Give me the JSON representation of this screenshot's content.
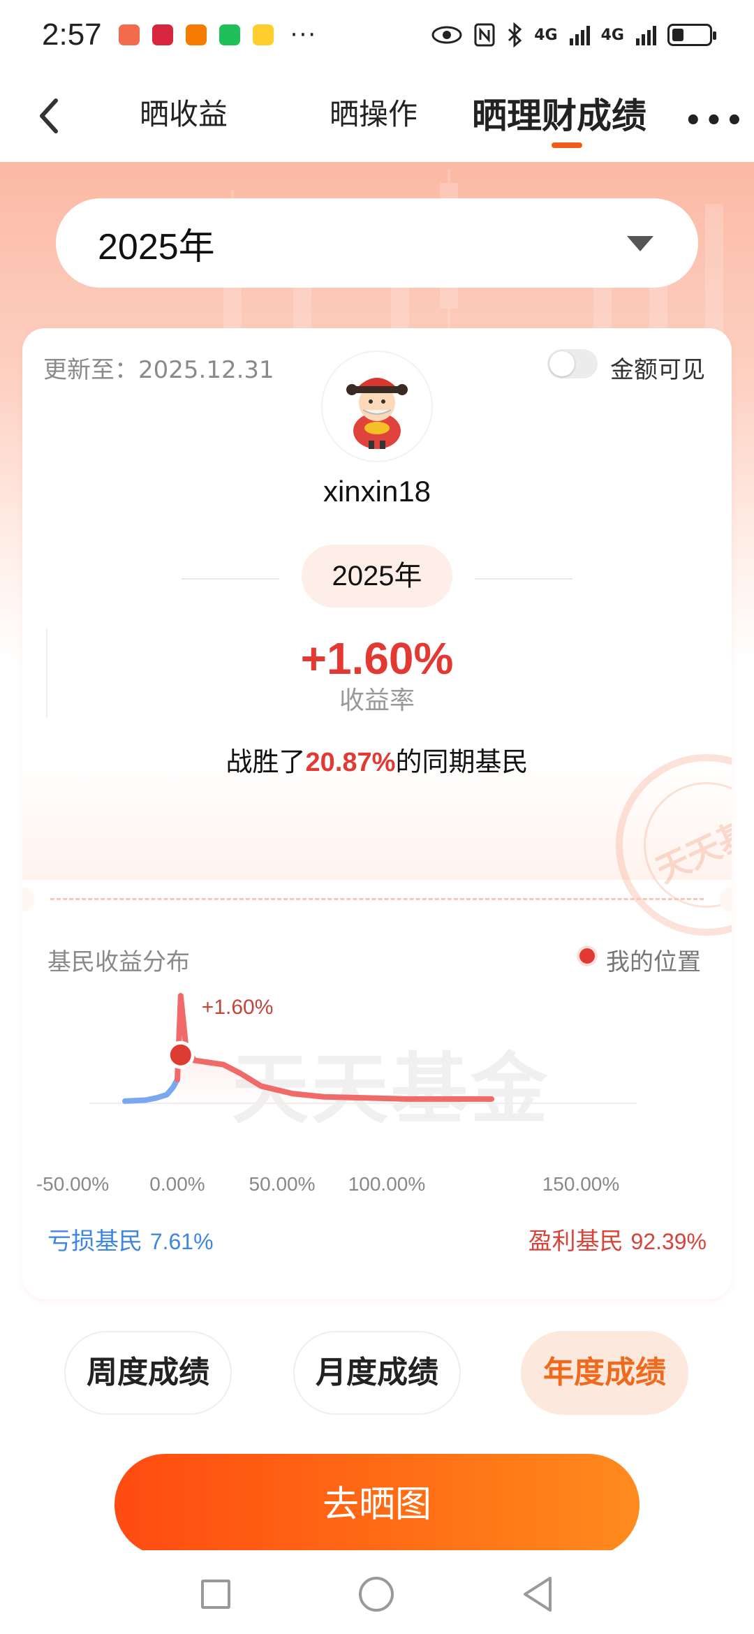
{
  "status": {
    "time": "2:57",
    "dots": "···",
    "net1": "4G",
    "net2": "4G"
  },
  "nav": {
    "tabs": [
      "晒收益",
      "晒操作",
      "晒理财成绩"
    ],
    "more": "•••"
  },
  "year_select": {
    "value": "2025年"
  },
  "card": {
    "update_text": "更新至：2025.12.31",
    "toggle_label": "金额可见",
    "username": "xinxin18",
    "year_pill": "2025年",
    "return_value": "+1.60%",
    "return_label": "收益率",
    "beat_prefix": "战胜了",
    "beat_pct": "20.87%",
    "beat_suffix": "的同期基民",
    "stamp_text": "天天基金"
  },
  "distribution": {
    "title": "基民收益分布",
    "legend": "我的位置",
    "watermark": "天天基金",
    "loss_label": "亏损基民",
    "loss_value": "7.61%",
    "gain_label": "盈利基民",
    "gain_value": "92.39%"
  },
  "chart_data": {
    "type": "area",
    "x_tick_labels": [
      "-50.00%",
      "0.00%",
      "50.00%",
      "100.00%",
      "150.00%"
    ],
    "x_ticks": [
      -50,
      0,
      50,
      100,
      150
    ],
    "marker": {
      "x": 1.6,
      "label": "+1.60%"
    },
    "series": [
      {
        "name": "亏损基民",
        "color": "#7aa8f0",
        "points": [
          [
            -25,
            0.02
          ],
          [
            -15,
            0.03
          ],
          [
            -10,
            0.05
          ],
          [
            -5,
            0.08
          ],
          [
            -2,
            0.15
          ],
          [
            0,
            0.22
          ]
        ]
      },
      {
        "name": "盈利基民",
        "color": "#f06a6a",
        "points": [
          [
            0,
            0.22
          ],
          [
            1.6,
            1.0
          ],
          [
            4,
            0.55
          ],
          [
            8,
            0.4
          ],
          [
            15,
            0.38
          ],
          [
            22,
            0.36
          ],
          [
            30,
            0.28
          ],
          [
            40,
            0.16
          ],
          [
            55,
            0.09
          ],
          [
            70,
            0.06
          ],
          [
            90,
            0.05
          ],
          [
            110,
            0.04
          ],
          [
            130,
            0.04
          ],
          [
            150,
            0.04
          ]
        ]
      }
    ]
  },
  "periods": {
    "week": "周度成绩",
    "month": "月度成绩",
    "year": "年度成绩"
  },
  "share": {
    "label": "去晒图"
  },
  "colors": {
    "accent": "#f06a1e",
    "profit": "#e23a32",
    "loss": "#3f86e2"
  }
}
